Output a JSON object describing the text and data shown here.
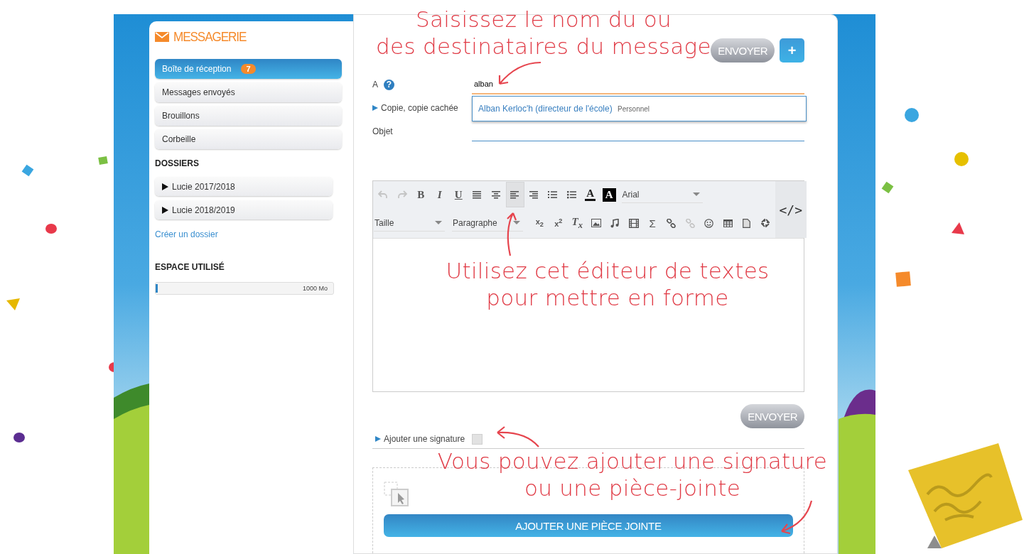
{
  "sidebar": {
    "title": "MESSAGERIE",
    "mailboxes": [
      {
        "label": "Boîte de réception",
        "badge": "7",
        "selected": true
      },
      {
        "label": "Messages envoyés",
        "selected": false
      },
      {
        "label": "Brouillons",
        "selected": false
      },
      {
        "label": "Corbeille",
        "selected": false
      }
    ],
    "folders_heading": "DOSSIERS",
    "folders": [
      {
        "label": "Lucie 2017/2018",
        "expanded": false
      },
      {
        "label": "Lucie 2018/2019",
        "expanded": false
      }
    ],
    "create_folder": "Créer un dossier",
    "storage_heading": "ESPACE UTILISÉ",
    "storage": {
      "level": 0.01,
      "reading": "1000 Mo"
    }
  },
  "compose": {
    "send_button": "ENVOYER",
    "add_button": "+",
    "to": {
      "label": "A",
      "help": "?",
      "value": "alban"
    },
    "suggestions": [
      {
        "name": "Alban Kerloc'h (directeur de l'école)",
        "group": "Personnel"
      }
    ],
    "cc": {
      "label": "Copie, copie cachée",
      "expanded": false
    },
    "subject": {
      "label": "Objet"
    },
    "toolbar": [
      {
        "items": [
          {
            "kind": "undo",
            "selected": false,
            "disabled": true
          },
          {
            "kind": "redo",
            "selected": false,
            "disabled": true
          },
          {
            "kind": "bold",
            "glyph": "B",
            "selected": false,
            "disabled": false
          },
          {
            "kind": "italic",
            "glyph": "I",
            "selected": false,
            "disabled": false
          },
          {
            "kind": "underline",
            "glyph": "U",
            "selected": false,
            "disabled": false
          },
          {
            "kind": "justify",
            "selected": false,
            "disabled": false
          },
          {
            "kind": "center",
            "selected": false,
            "disabled": false
          },
          {
            "kind": "left",
            "selected": true,
            "disabled": false
          },
          {
            "kind": "right",
            "selected": false,
            "disabled": false
          },
          {
            "kind": "bullets",
            "selected": false,
            "disabled": false
          },
          {
            "kind": "numbers",
            "selected": false,
            "disabled": false
          },
          {
            "kind": "color",
            "glyph": "A",
            "selected": false,
            "disabled": false
          },
          {
            "kind": "bgcolor",
            "glyph": "A",
            "selected": false,
            "disabled": false
          },
          {
            "kind": "select",
            "value": "Arial"
          }
        ]
      },
      {
        "items": [
          {
            "kind": "select",
            "placeholder": "Taille"
          },
          {
            "kind": "select",
            "value": "Paragraphe"
          },
          {
            "kind": "sub",
            "glyph": "x$_{2}$",
            "selected": false,
            "disabled": false
          },
          {
            "kind": "sup",
            "glyph": "x$^{2}$",
            "selected": false,
            "disabled": false
          },
          {
            "kind": "clear",
            "glyph": "T$_{x}$",
            "selected": false,
            "disabled": false
          },
          {
            "kind": "image",
            "selected": false,
            "disabled": false
          },
          {
            "kind": "music",
            "selected": false,
            "disabled": false
          },
          {
            "kind": "film",
            "selected": false,
            "disabled": false
          },
          {
            "kind": "sigma",
            "glyph": "Σ",
            "selected": false,
            "disabled": false
          },
          {
            "kind": "link",
            "selected": false,
            "disabled": false
          },
          {
            "kind": "unlink",
            "selected": false,
            "disabled": true
          },
          {
            "kind": "smiley",
            "selected": false,
            "disabled": false
          },
          {
            "kind": "table",
            "selected": false,
            "disabled": false
          },
          {
            "kind": "document",
            "selected": false,
            "disabled": false
          },
          {
            "kind": "expand",
            "selected": false,
            "disabled": false
          }
        ]
      }
    ],
    "code_button": "</>",
    "send_button_bottom": "ENVOYER",
    "signature": {
      "label": "Ajouter une signature",
      "expanded": false,
      "checked": false
    },
    "attach_button": "AJOUTER UNE PIÈCE JOINTE"
  },
  "annotations": [
    {
      "lines": [
        "Saisissez le nom du ou",
        "des destinataires du message"
      ]
    },
    {
      "lines": [
        "Utilisez cet éditeur de textes",
        "pour mettre en forme"
      ]
    },
    {
      "lines": [
        "Vous pouvez ajouter une signature",
        "ou une pièce-jointe"
      ]
    }
  ]
}
